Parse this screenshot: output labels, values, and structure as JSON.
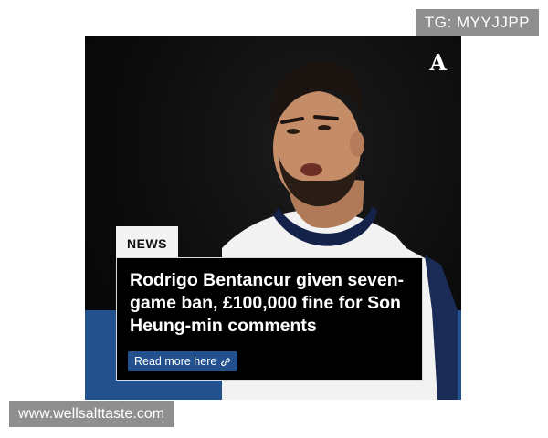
{
  "watermarks": {
    "telegram": "TG: MYYJJPP",
    "website": "www.wellsalttaste.com"
  },
  "card": {
    "brand_logo": "A",
    "tag": "NEWS",
    "headline": "Rodrigo Bentancur given seven-game ban, £100,000 fine for Son Heung-min comments",
    "read_more_label": "Read more here",
    "read_more_icon": "link-icon"
  },
  "colors": {
    "accent_blue": "#23518e",
    "background_dark": "#0c0c0c",
    "watermark_gray": "#8f8f8f"
  }
}
